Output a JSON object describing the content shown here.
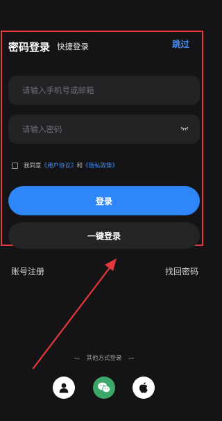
{
  "header": {
    "tab_password": "密码登录",
    "tab_quick": "快捷登录",
    "skip": "跳过"
  },
  "form": {
    "phone_placeholder": "请输入手机号或邮箱",
    "password_placeholder": "请输入密码"
  },
  "agreement": {
    "prefix": "我同意",
    "user_agreement": "《用户协议》",
    "and": "和",
    "privacy_policy": "《隐私政策》"
  },
  "buttons": {
    "login": "登录",
    "one_key_login": "一键登录"
  },
  "links": {
    "register": "账号注册",
    "forgot_password": "找回密码"
  },
  "other_login": {
    "label": "其他方式登录",
    "icons": [
      "user-icon",
      "wechat-icon",
      "apple-icon"
    ]
  },
  "colors": {
    "accent": "#2f86f6",
    "link": "#3e8ef7",
    "highlight": "#e5383d",
    "wechat": "#3ea86a",
    "background": "#141416"
  }
}
